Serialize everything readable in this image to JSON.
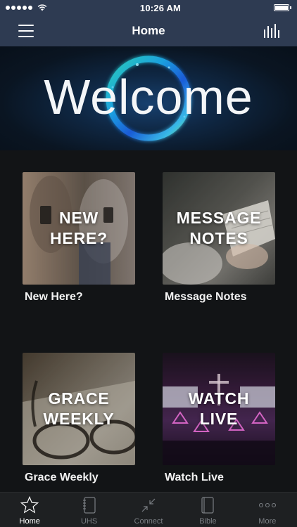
{
  "status_bar": {
    "time": "10:26 AM"
  },
  "nav": {
    "title": "Home",
    "menu_icon": "hamburger-menu-icon",
    "right_icon": "audio-bars-icon"
  },
  "banner": {
    "text": "Welcome"
  },
  "tiles": [
    {
      "overlay": "NEW\nHERE?",
      "label": "New Here?"
    },
    {
      "overlay": "MESSAGE\nNOTES",
      "label": "Message Notes"
    },
    {
      "overlay": "GRACE\nWEEKLY",
      "label": "Grace Weekly"
    },
    {
      "overlay": "WATCH\nLIVE",
      "label": "Watch Live"
    }
  ],
  "tabs": [
    {
      "label": "Home",
      "icon": "star-icon",
      "active": true
    },
    {
      "label": "UHS",
      "icon": "notebook-icon",
      "active": false
    },
    {
      "label": "Connect",
      "icon": "collapse-arrows-icon",
      "active": false
    },
    {
      "label": "Bible",
      "icon": "book-icon",
      "active": false
    },
    {
      "label": "More",
      "icon": "more-dots-icon",
      "active": false
    }
  ],
  "colors": {
    "nav_bg": "#2e3b52",
    "body_bg": "#121416",
    "tab_bar_bg": "#1e2022",
    "tab_inactive": "#7a7e83",
    "tab_active": "#ffffff"
  }
}
